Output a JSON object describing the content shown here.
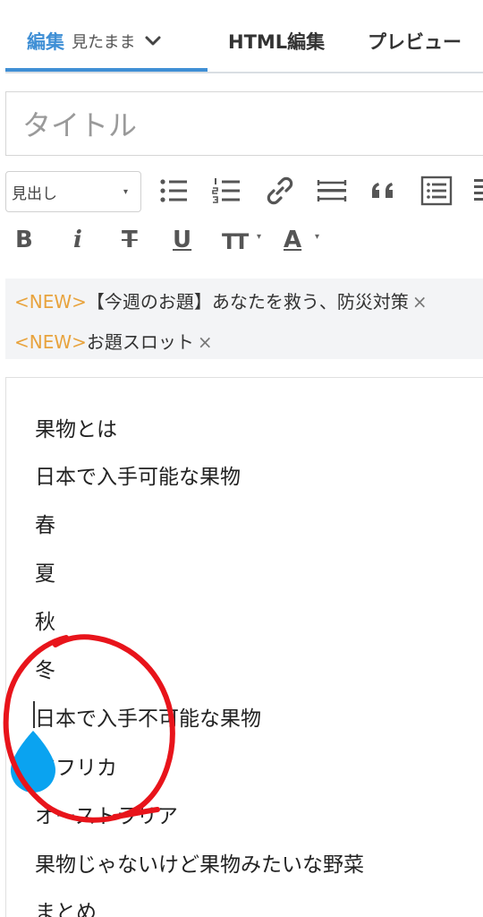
{
  "tabs": {
    "edit_label": "編集",
    "edit_mode": "見たまま",
    "html_label": "HTML編集",
    "preview_label": "プレビュー"
  },
  "title": {
    "placeholder": "タイトル"
  },
  "toolbar": {
    "heading_select": "見出し",
    "icons": [
      "bullet-list-icon",
      "numbered-list-icon",
      "link-icon",
      "horizontal-rule-icon",
      "quote-icon",
      "table-of-contents-icon",
      "more-icon"
    ],
    "format": {
      "bold": "B",
      "italic": "i",
      "strike": "T",
      "underline": "U",
      "size": "TT",
      "color": "A"
    }
  },
  "topics": [
    {
      "tag": "<NEW>",
      "text": "【今週のお題】あなたを救う、防災対策",
      "close": "×"
    },
    {
      "tag": "<NEW>",
      "text": "お題スロット",
      "close": "×"
    }
  ],
  "content": {
    "lines": [
      "果物とは",
      "日本で入手可能な果物",
      "春",
      "夏",
      "秋",
      "冬",
      "日本で入手不可能な果物",
      "アフリカ",
      "オーストラリア",
      "果物じゃないけど果物みたいな野菜",
      "まとめ"
    ]
  },
  "colors": {
    "accent": "#3f8fd5",
    "new_tag": "#e8a33d",
    "annotation": "#e8141b",
    "handle": "#0aa3f0"
  }
}
